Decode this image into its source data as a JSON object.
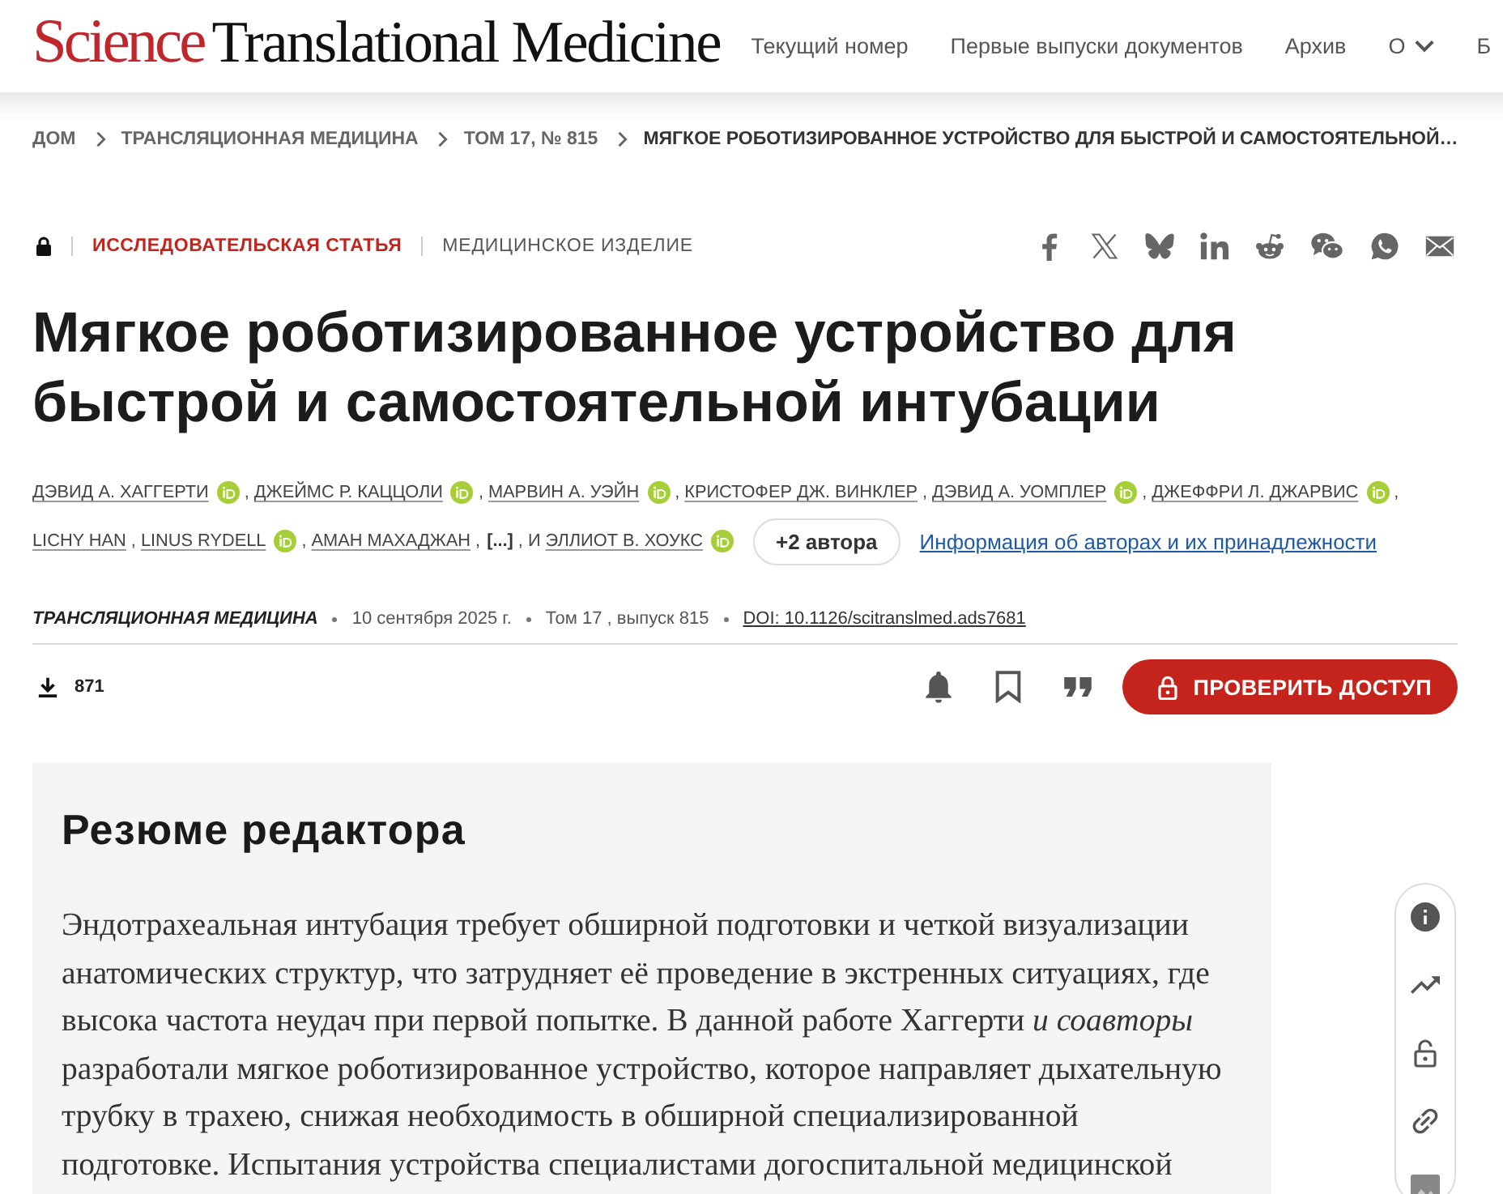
{
  "header": {
    "logo": {
      "brand": "Science",
      "title": "Translational Medicine"
    },
    "nav": [
      {
        "label": "Текущий номер",
        "dropdown": false
      },
      {
        "label": "Первые выпуски документов",
        "dropdown": false
      },
      {
        "label": "Архив",
        "dropdown": false
      },
      {
        "label": "О",
        "dropdown": true
      },
      {
        "label": "Б",
        "dropdown": false
      }
    ]
  },
  "breadcrumbs": [
    {
      "label": "ДОМ",
      "current": false
    },
    {
      "label": "ТРАНСЛЯЦИОННАЯ МЕДИЦИНА",
      "current": false
    },
    {
      "label": "ТОМ 17, № 815",
      "current": false
    },
    {
      "label": "МЯГКОЕ РОБОТИЗИРОВАННОЕ УСТРОЙСТВО ДЛЯ БЫСТРОЙ И САМОСТОЯТЕЛЬНОЙ…",
      "current": true
    }
  ],
  "article": {
    "locked": true,
    "type": "ИССЛЕДОВАТЕЛЬСКАЯ СТАТЬЯ",
    "subject": "МЕДИЦИНСКОЕ ИЗДЕЛИЕ",
    "title": "Мягкое роботизированное устройство для быстрой и самостоятельной интубации",
    "authors": [
      {
        "kind": "author",
        "name": "ДЭВИД А. ХАГГЕРТИ",
        "orcid": true,
        "separator": ","
      },
      {
        "kind": "author",
        "name": "ДЖЕЙМС Р. КАЦЦОЛИ",
        "orcid": true,
        "separator": ","
      },
      {
        "kind": "author",
        "name": "МАРВИН А. УЭЙН",
        "orcid": true,
        "separator": ","
      },
      {
        "kind": "author",
        "name": "КРИСТОФЕР ДЖ. ВИНКЛЕР",
        "orcid": false,
        "separator": ","
      },
      {
        "kind": "author",
        "name": "ДЭВИД А. УОМПЛЕР",
        "orcid": true,
        "separator": ","
      },
      {
        "kind": "author",
        "name": "ДЖЕФФРИ Л. ДЖАРВИС",
        "orcid": true,
        "separator": ","
      },
      {
        "kind": "author",
        "name": "LICHY HAN",
        "orcid": false,
        "separator": ","
      },
      {
        "kind": "author",
        "name": "LINUS RYDELL",
        "orcid": true,
        "separator": ","
      },
      {
        "kind": "author",
        "name": "АМАН МАХАДЖАН",
        "orcid": false,
        "separator": ","
      },
      {
        "kind": "omitted",
        "name": "[...]",
        "separator": ", И"
      },
      {
        "kind": "author",
        "name": "ЭЛЛИОТ В. ХОУКС",
        "orcid": true
      }
    ],
    "more_authors_button": "+2 автора",
    "affiliations_link": "Информация об авторах и их принадлежности",
    "journal": "ТРАНСЛЯЦИОННАЯ МЕДИЦИНА",
    "date": "10 сентября 2025 г.",
    "issue": "Том 17 , выпуск 815",
    "doi": "DOI: 10.1126/scitranslmed.ads7681",
    "downloads": "871",
    "access_button": "ПРОВЕРИТЬ ДОСТУП"
  },
  "editor_summary": {
    "heading": "Резюме редактора",
    "text": "Эндотрахеальная интубация требует обширной подготовки и четкой визуализации анатомических структур, что затрудняет её проведение в экстренных ситуациях, где высока частота неудач при первой попытке. В данной работе Хаггерти *и соавторы* разработали мягкое роботизированное устройство, которое направляет дыхательную трубку в трахею, снижая необходимость в обширной специализированной подготовке. Испытания устройства специалистами догоспитальной медицинской"
  }
}
